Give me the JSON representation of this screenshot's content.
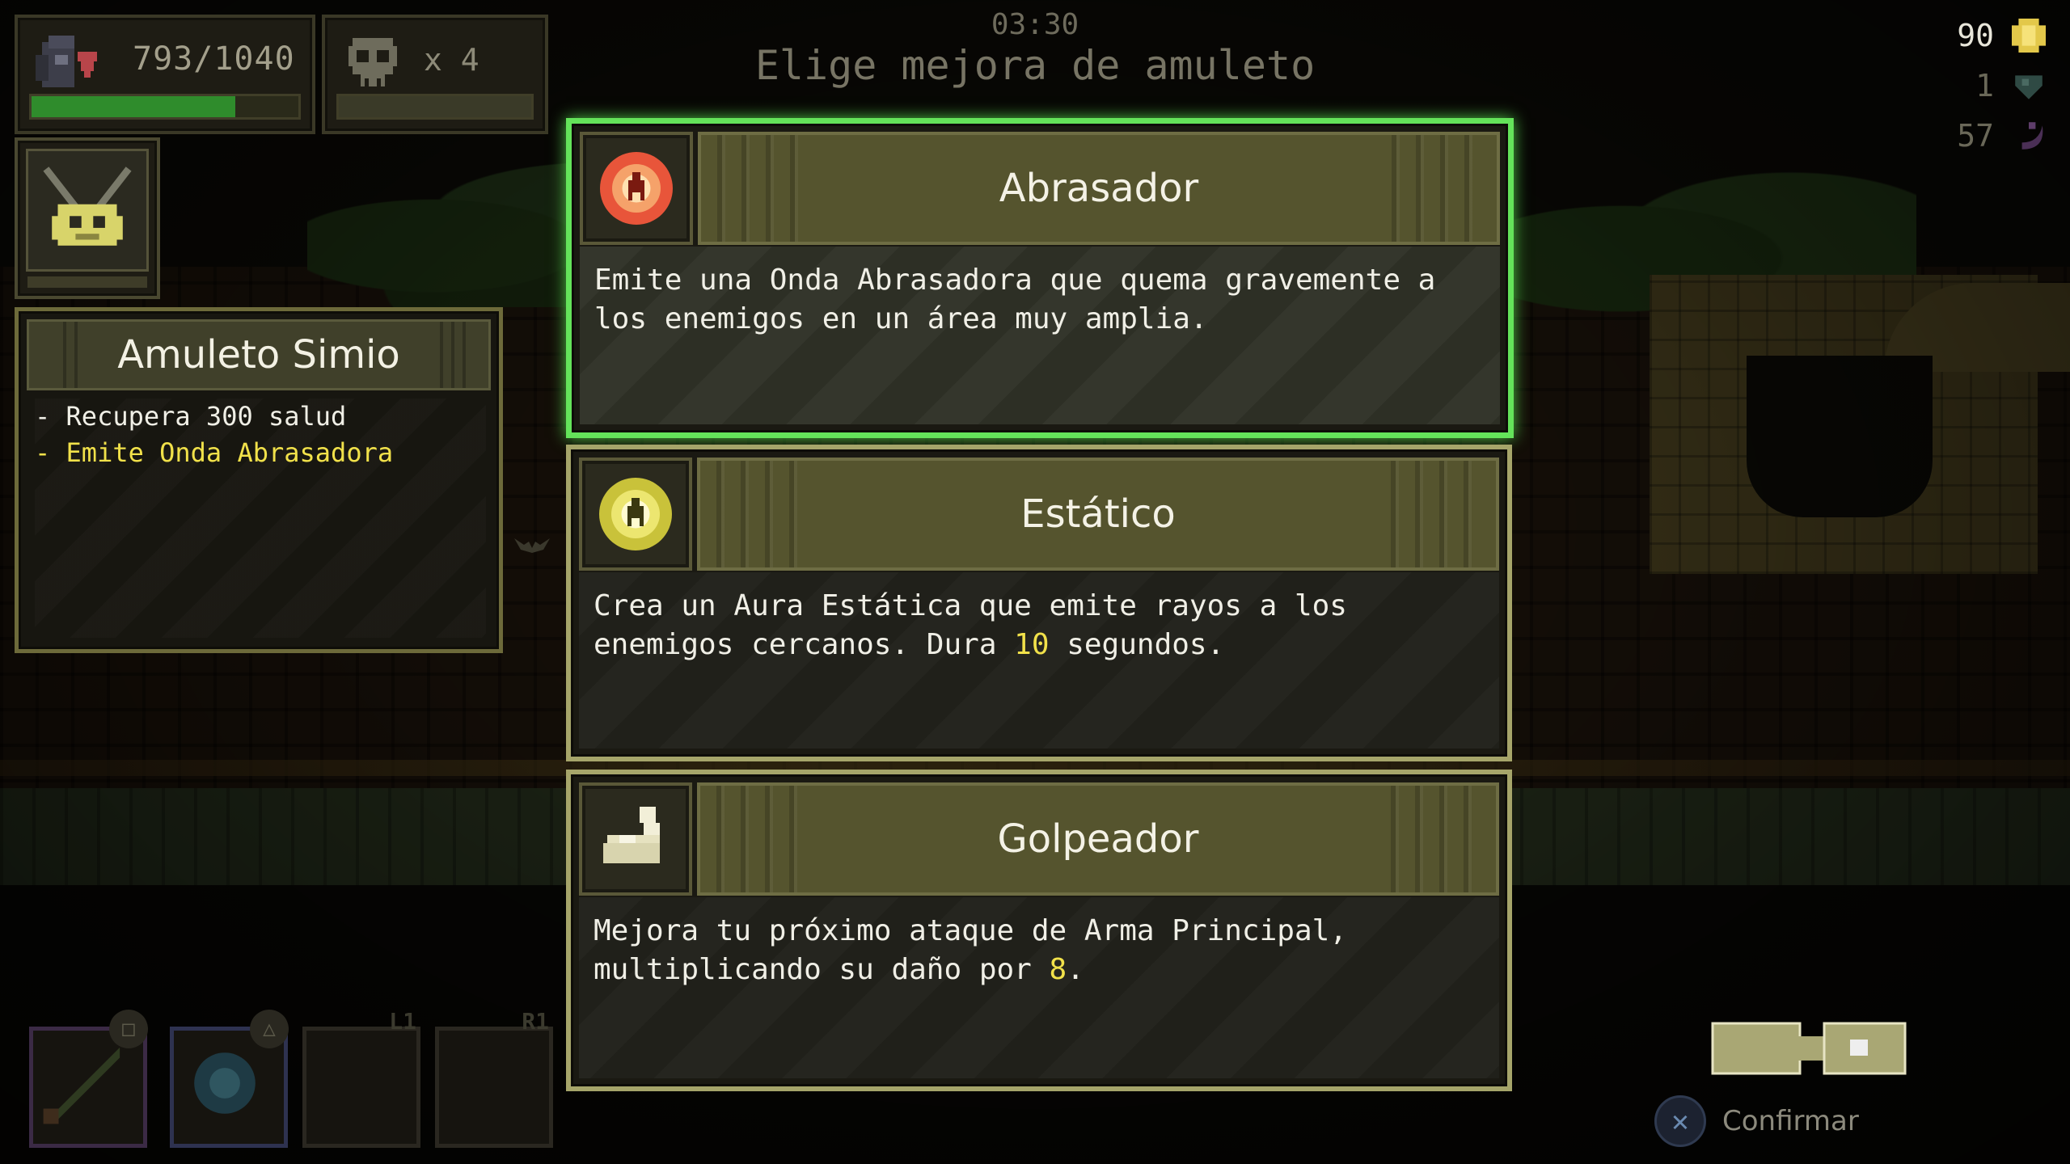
{
  "hud": {
    "health_text": "793/1040",
    "health_fraction": 0.7625,
    "kills_text": "x 4",
    "timer": "03:30",
    "title": "Elige mejora de amuleto"
  },
  "resources": {
    "gold": "90",
    "gems": "1",
    "moons": "57"
  },
  "amulet": {
    "name": "Amuleto Simio",
    "line1": "- Recupera 300 salud",
    "line2": "- Emite Onda Abrasadora"
  },
  "cards": [
    {
      "name": "Abrasador",
      "icon": "fire-orb-icon",
      "desc_a": "Emite una Onda Abrasadora que quema gravemente a los enemigos en un área muy amplia.",
      "desc_hl": "",
      "desc_b": ""
    },
    {
      "name": "Estático",
      "icon": "static-orb-icon",
      "desc_a": "Crea un Aura Estática que emite rayos a los enemigos cercanos. Dura ",
      "desc_hl": "10",
      "desc_b": " segundos."
    },
    {
      "name": "Golpeador",
      "icon": "flexed-arm-icon",
      "desc_a": "Mejora tu próximo ataque de Arma Principal, multiplicando su daño por ",
      "desc_hl": "8",
      "desc_b": "."
    }
  ],
  "skills": {
    "slot3_label": "L1",
    "slot4_label": "R1"
  },
  "confirm": {
    "button_glyph": "✕",
    "label": "Confirmar"
  },
  "colors": {
    "selected_border": "#64e35a",
    "card_border": "#a6a56a",
    "highlight_text": "#f1e14a",
    "health_bar": "#2f8c2c"
  }
}
